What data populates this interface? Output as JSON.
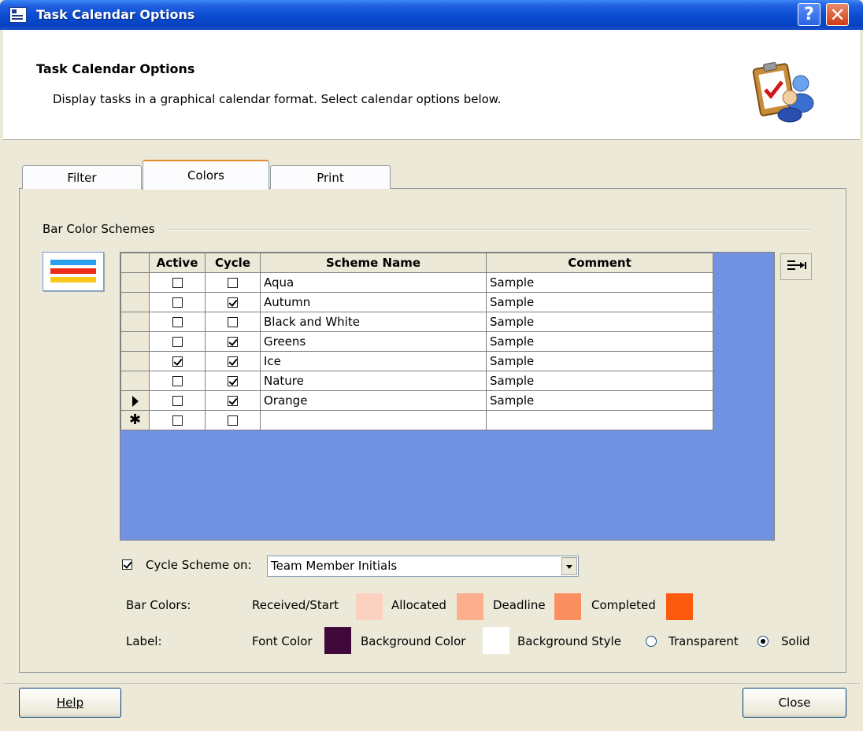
{
  "window": {
    "title": "Task Calendar Options"
  },
  "header": {
    "title": "Task Calendar Options",
    "description": "Display tasks in a graphical calendar format. Select calendar options below."
  },
  "tabs": [
    {
      "label": "Filter",
      "selected": false
    },
    {
      "label": "Colors",
      "selected": true
    },
    {
      "label": "Print",
      "selected": false
    }
  ],
  "group": {
    "label": "Bar Color Schemes"
  },
  "grid": {
    "columns": [
      "Active",
      "Cycle",
      "Scheme Name",
      "Comment"
    ],
    "rows": [
      {
        "active": false,
        "cycle": false,
        "name": "Aqua",
        "comment": "Sample"
      },
      {
        "active": false,
        "cycle": true,
        "name": "Autumn",
        "comment": "Sample"
      },
      {
        "active": false,
        "cycle": false,
        "name": "Black and White",
        "comment": "Sample"
      },
      {
        "active": false,
        "cycle": true,
        "name": "Greens",
        "comment": "Sample"
      },
      {
        "active": true,
        "cycle": true,
        "name": "Ice",
        "comment": "Sample"
      },
      {
        "active": false,
        "cycle": true,
        "name": "Nature",
        "comment": "Sample"
      },
      {
        "active": false,
        "cycle": true,
        "name": "Orange",
        "comment": "Sample",
        "current": true
      }
    ],
    "new_row": {
      "active": false,
      "cycle": false
    }
  },
  "cycle": {
    "checked": true,
    "label": "Cycle Scheme on:",
    "value": "Team Member Initials"
  },
  "bar_colors": {
    "label": "Bar Colors:",
    "items": [
      {
        "label": "Received/Start",
        "color": "#fbd0bf"
      },
      {
        "label": "Allocated",
        "color": "#fbaf8f"
      },
      {
        "label": "Deadline",
        "color": "#fb8f5f"
      },
      {
        "label": "Completed",
        "color": "#fb5a0f"
      }
    ]
  },
  "label_row": {
    "label": "Label:",
    "font_color_label": "Font Color",
    "font_color": "#3f0a3a",
    "background_color_label": "Background Color",
    "background_color": "#ffffff",
    "background_style_label": "Background Style",
    "options": [
      {
        "label": "Transparent",
        "selected": false
      },
      {
        "label": "Solid",
        "selected": true
      }
    ]
  },
  "buttons": {
    "help": "Help",
    "close": "Close"
  }
}
